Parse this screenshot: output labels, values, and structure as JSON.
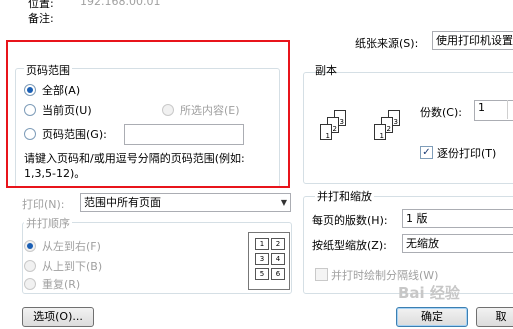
{
  "top": {
    "location_label": "位置:",
    "location_value": "192.168.00.01",
    "comment_label": "备注:",
    "paper_source_label": "纸张来源(S):",
    "paper_source_value": "使用打印机设置"
  },
  "page_range": {
    "title": "页码范围",
    "all_label": "全部(A)",
    "current_label": "当前页(U)",
    "selection_label": "所选内容(E)",
    "pages_label": "页码范围(G):",
    "pages_value": "",
    "hint_line1": "请键入页码和/或用逗号分隔的页码范围(例如:",
    "hint_line2": "1,3,5-12)。",
    "selected": "all"
  },
  "copies": {
    "title": "副本",
    "count_label": "份数(C):",
    "count_value": "1",
    "collate_label": "逐份打印(T)",
    "collate_checked": true
  },
  "print": {
    "label": "打印(N):",
    "value": "范围中所有页面"
  },
  "order": {
    "title": "并打顺序",
    "left_to_right": "从左到右(F)",
    "top_to_bottom": "从上到下(B)",
    "repeat": "重复(R)"
  },
  "zoom": {
    "title": "并打和缩放",
    "pages_per_sheet_label": "每页的版数(H):",
    "pages_per_sheet_value": "1 版",
    "scale_label": "按纸型缩放(Z):",
    "scale_value": "无缩放",
    "draw_borders_label": "并打时绘制分隔线(W)"
  },
  "buttons": {
    "options": "选项(O)...",
    "ok": "确定",
    "cancel": "取"
  },
  "watermark": "Bai 经验",
  "colors": {
    "highlight": "#e8141b",
    "accent": "#1a5fb4"
  }
}
